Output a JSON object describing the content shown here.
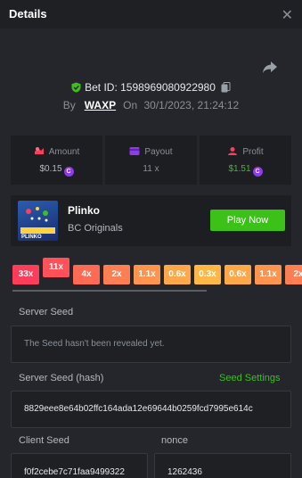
{
  "header": {
    "title": "Details",
    "close_glyph": "✕"
  },
  "bet": {
    "id_text": "Bet ID: 1598969080922980",
    "by_label": "By",
    "user": "WAXP",
    "on_label": "On",
    "datetime": "30/1/2023, 21:24:12"
  },
  "stats": {
    "amount": {
      "label": "Amount",
      "value": "$0.15",
      "icon": "amount-icon"
    },
    "payout": {
      "label": "Payout",
      "value": "11 x",
      "icon": "payout-icon"
    },
    "profit": {
      "label": "Profit",
      "value": "$1.51",
      "icon": "profit-icon"
    },
    "coin_glyph": "C"
  },
  "game": {
    "name": "Plinko",
    "provider": "BC Originals",
    "play_label": "Play Now",
    "thumb_text": "PLINKO"
  },
  "multipliers": [
    {
      "label": "33x",
      "color": "#ff3d5a"
    },
    {
      "label": "11x",
      "color": "#ff5157",
      "raised": true
    },
    {
      "label": "4x",
      "color": "#ff6a55"
    },
    {
      "label": "2x",
      "color": "#ff7f52"
    },
    {
      "label": "1.1x",
      "color": "#ff944e"
    },
    {
      "label": "0.6x",
      "color": "#ffa84a"
    },
    {
      "label": "0.3x",
      "color": "#ffb845"
    },
    {
      "label": "0.6x",
      "color": "#ffa84a"
    },
    {
      "label": "1.1x",
      "color": "#ff944e"
    },
    {
      "label": "2x",
      "color": "#ff7f52"
    }
  ],
  "seeds": {
    "server_label": "Server Seed",
    "server_value": "The Seed hasn't been revealed yet.",
    "server_hash_label": "Server Seed (hash)",
    "seed_settings_label": "Seed Settings",
    "server_hash_value": "8829eee8e64b02ffc164ada12e69644b0259fcd7995e614c",
    "client_label": "Client Seed",
    "client_value": "f0f2cebe7c71faa9499322",
    "nonce_label": "nonce",
    "nonce_value": "1262436"
  },
  "colors": {
    "accent": "#3bc117",
    "coin": "#8e3bea",
    "profit": "#3bc117",
    "shield": "#3bc117"
  }
}
